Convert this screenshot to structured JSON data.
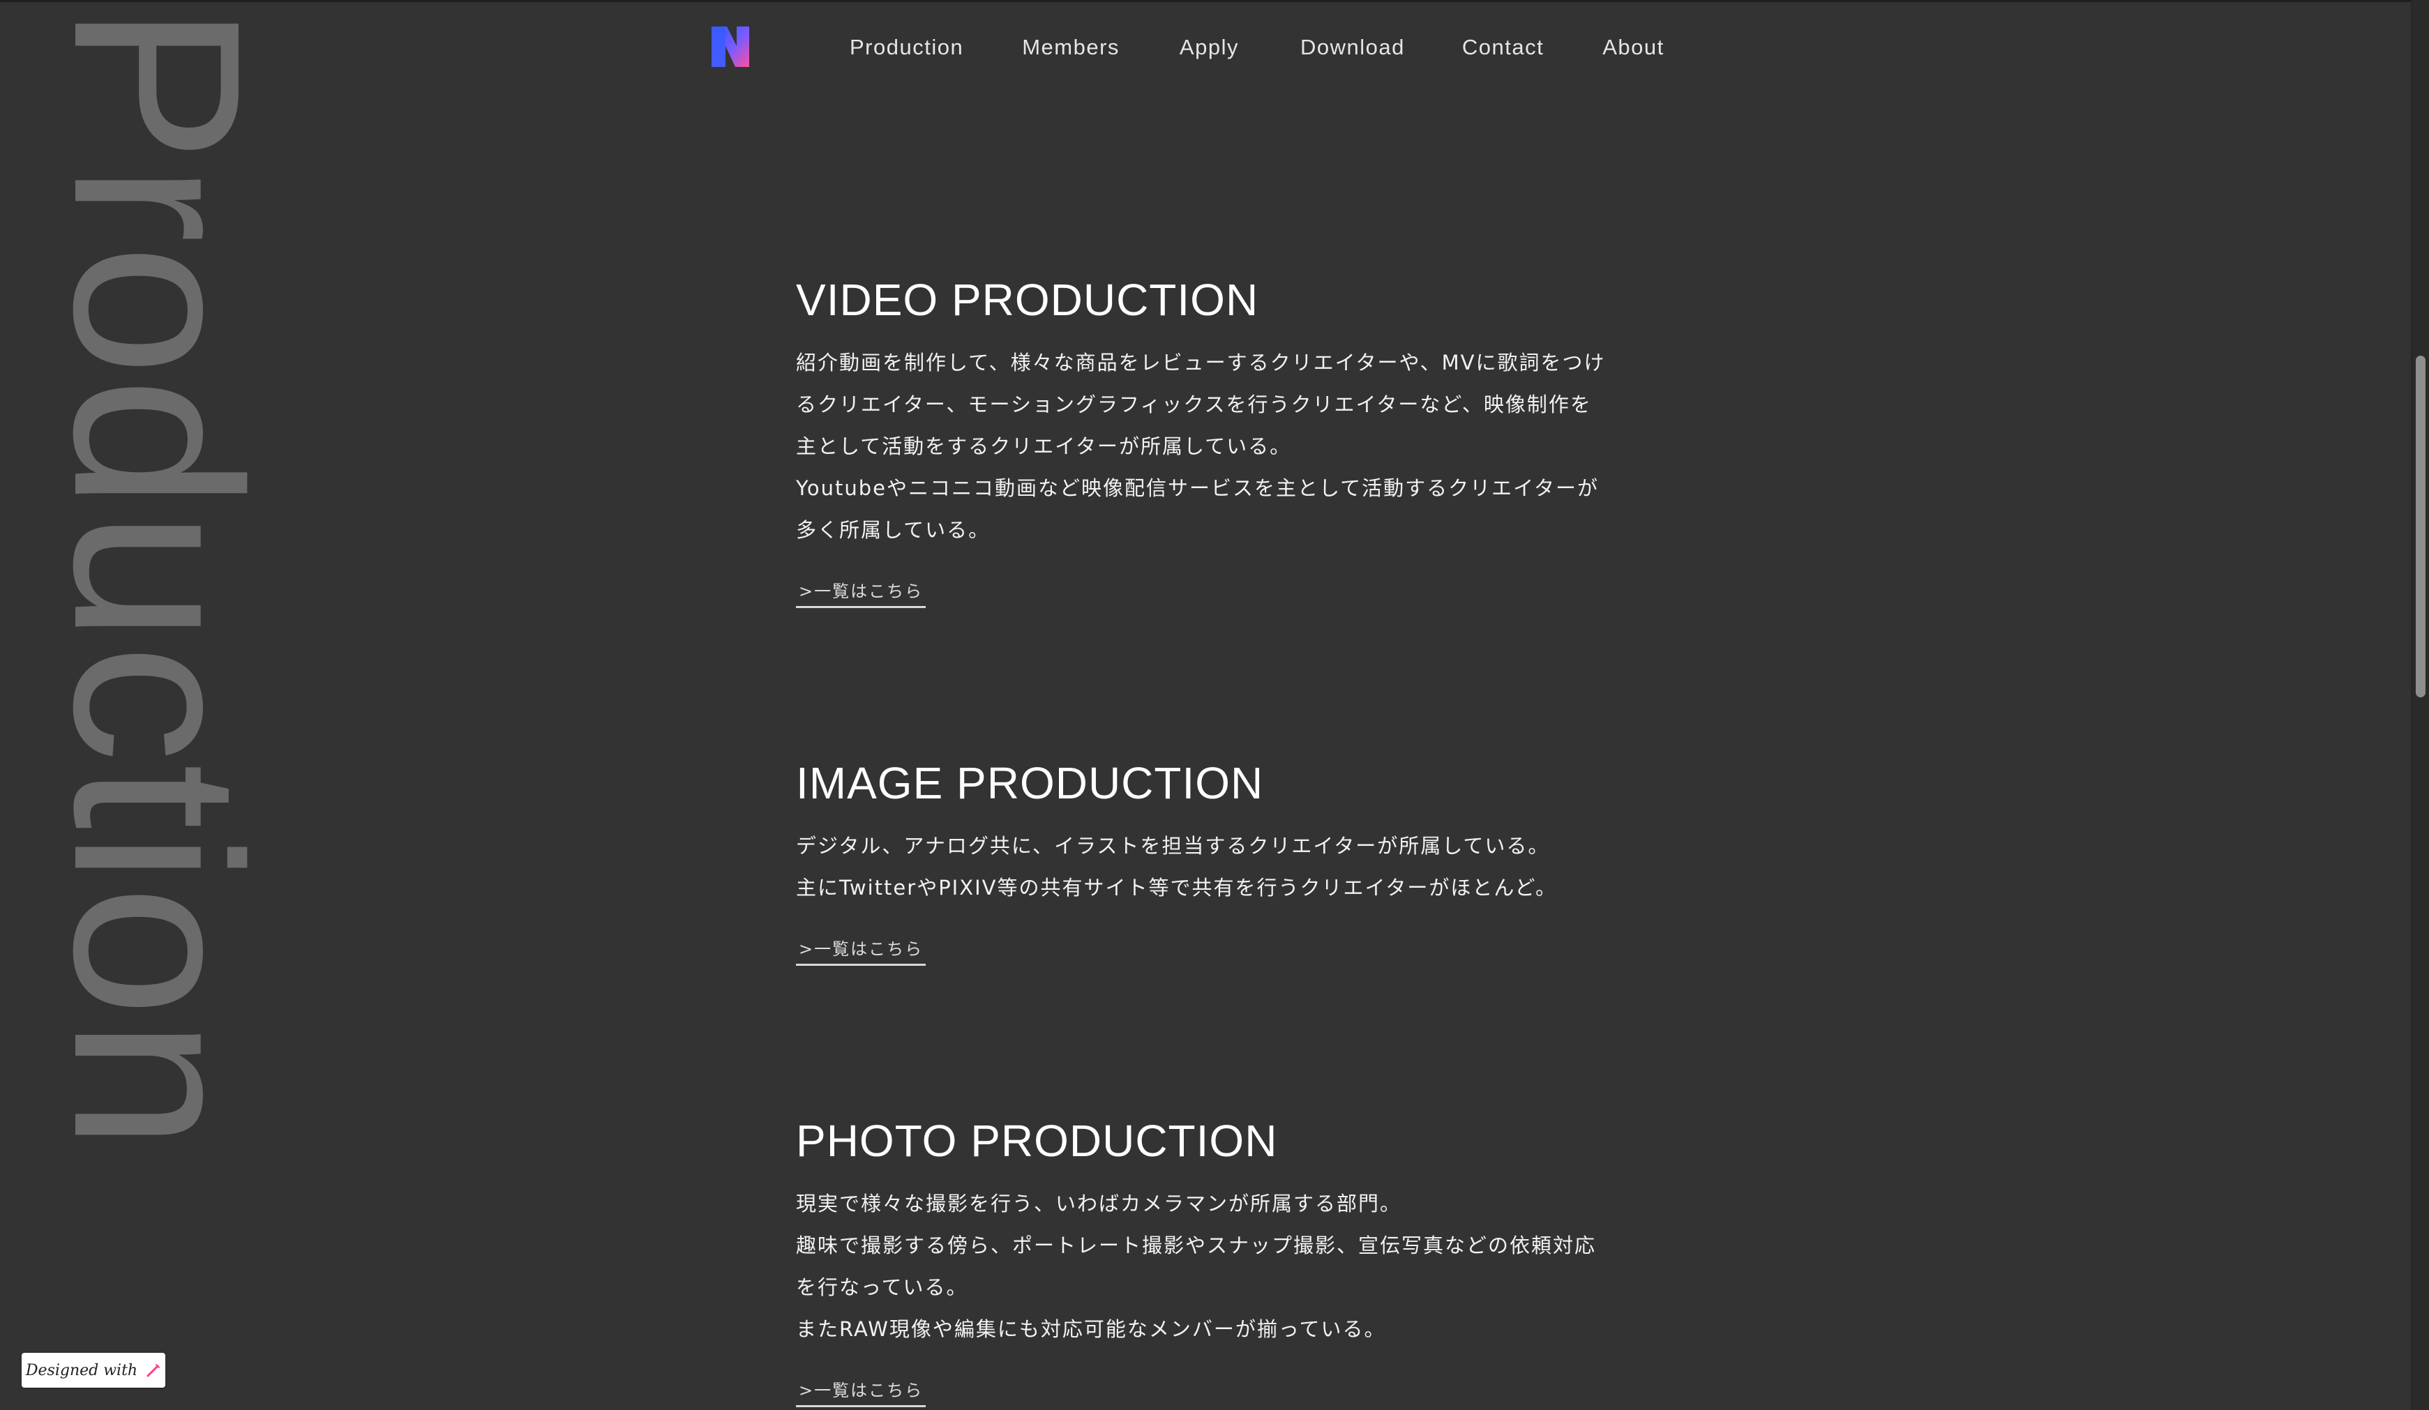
{
  "nav": {
    "logo_icon": "studio-logo-icon",
    "items": [
      "Production",
      "Members",
      "Apply",
      "Download",
      "Contact",
      "About"
    ]
  },
  "hero": {
    "vertical_word": "Production"
  },
  "sections": [
    {
      "title": "VIDEO PRODUCTION",
      "lines": [
        "紹介動画を制作して、様々な商品をレビューするクリエイターや、MVに歌詞をつけ",
        "るクリエイター、モーショングラフィックスを行うクリエイターなど、映像制作を",
        "主として活動をするクリエイターが所属している。",
        "Youtubeやニコニコ動画など映像配信サービスを主として活動するクリエイターが",
        "多く所属している。"
      ],
      "link": ">一覧はこちら"
    },
    {
      "title": "IMAGE PRODUCTION",
      "lines": [
        "デジタル、アナログ共に、イラストを担当するクリエイターが所属している。",
        "主にTwitterやPIXIV等の共有サイト等で共有を行うクリエイターがほとんど。"
      ],
      "link": ">一覧はこちら"
    },
    {
      "title": "PHOTO PRODUCTION",
      "lines": [
        "現実で様々な撮影を行う、いわばカメラマンが所属する部門。",
        "趣味で撮影する傍ら、ポートレート撮影やスナップ撮影、宣伝写真などの依頼対応",
        "を行なっている。",
        "またRAW現像や編集にも対応可能なメンバーが揃っている。"
      ],
      "link": ">一覧はこちら"
    }
  ],
  "badge": {
    "text": "Designed with",
    "icon": "pen-icon"
  },
  "colors": {
    "background": "#333333",
    "text": "#ffffff",
    "muted_watermark": "#6b6b6b",
    "logo_gradient_start": "#3d6bff",
    "logo_gradient_end": "#ff4fa0",
    "badge_accent": "#ff3c8c"
  }
}
